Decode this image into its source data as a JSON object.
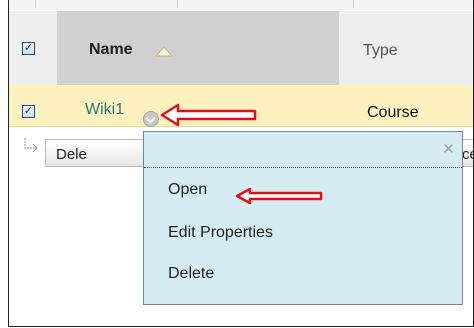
{
  "table": {
    "header": {
      "select_all_checked": true,
      "checkbox_glyph": "✓",
      "name_label": "Name",
      "sort_icon": "triangle-up-icon",
      "type_label": "Type"
    },
    "row": {
      "checked": true,
      "checkbox_glyph": "✓",
      "name": "Wiki1",
      "options_icon": "chevron-down-circle-icon",
      "type": "Course"
    }
  },
  "action_bar": {
    "arrow_icon": "corner-down-right-arrow-icon",
    "delete_label": "Dele",
    "second_label": "ce"
  },
  "context_menu": {
    "close_glyph": "×",
    "items": [
      {
        "label": "Open"
      },
      {
        "label": "Edit Properties"
      },
      {
        "label": "Delete"
      }
    ]
  },
  "annotations": {
    "arrow_color": "#e0101a",
    "arrow_icon": "left-arrow-icon"
  },
  "colors": {
    "header_background": "#eeeeee",
    "sorted_column_background": "#d0d0d0",
    "selected_row_background": "#fdf1c0",
    "link_color": "#1c7a7a",
    "menu_background": "#d4ebf2"
  }
}
